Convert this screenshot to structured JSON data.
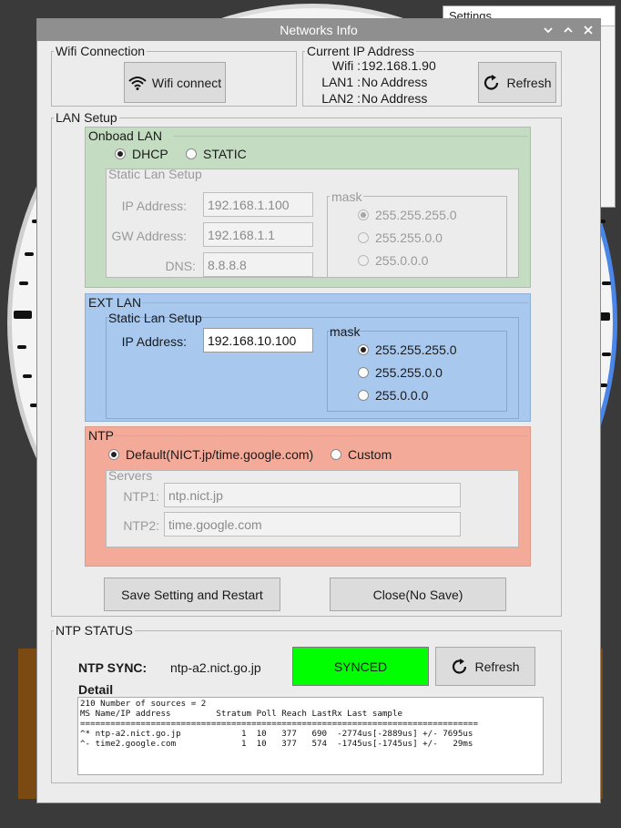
{
  "window": {
    "title": "Networks Info"
  },
  "background": {
    "settings_title": "Settings"
  },
  "wifi": {
    "legend": "Wifi Connection",
    "connect_label": "Wifi connect"
  },
  "current_ip": {
    "legend": "Current IP Address",
    "rows": [
      {
        "label": "Wifi :",
        "value": "192.168.1.90"
      },
      {
        "label": "LAN1 :",
        "value": "No Address"
      },
      {
        "label": "LAN2 :",
        "value": "No Address"
      }
    ],
    "refresh_label": "Refresh"
  },
  "lan_setup": {
    "legend": "LAN Setup",
    "onboard": {
      "legend": "Onboad LAN",
      "dhcp_label": "DHCP",
      "static_label": "STATIC",
      "mode": "DHCP",
      "static_legend": "Static Lan Setup",
      "ip_label": "IP Address:",
      "ip_value": "192.168.1.100",
      "gw_label": "GW Address:",
      "gw_value": "192.168.1.1",
      "dns_label": "DNS:",
      "dns_value": "8.8.8.8",
      "mask_legend": "mask",
      "masks": [
        "255.255.255.0",
        "255.255.0.0",
        "255.0.0.0"
      ],
      "mask_selected": 0
    },
    "ext": {
      "legend": "EXT LAN",
      "static_legend": "Static Lan Setup",
      "ip_label": "IP Address:",
      "ip_value": "192.168.10.100",
      "mask_legend": "mask",
      "masks": [
        "255.255.255.0",
        "255.255.0.0",
        "255.0.0.0"
      ],
      "mask_selected": 0
    },
    "ntp": {
      "legend": "NTP",
      "default_label": "Default(NICT.jp/time.google.com)",
      "custom_label": "Custom",
      "selected": "default",
      "servers_legend": "Servers",
      "ntp1_label": "NTP1:",
      "ntp1_value": "ntp.nict.jp",
      "ntp2_label": "NTP2:",
      "ntp2_value": "time.google.com"
    },
    "save_label": "Save Setting and Restart",
    "close_label": "Close(No Save)"
  },
  "ntp_status": {
    "legend": "NTP STATUS",
    "sync_label": "NTP SYNC:",
    "sync_server": "ntp-a2.nict.go.jp",
    "sync_state": "SYNCED",
    "sync_color": "#00ff00",
    "refresh_label": "Refresh",
    "detail_label": "Detail",
    "detail_lines": [
      "210 Number of sources = 2",
      "MS Name/IP address         Stratum Poll Reach LastRx Last sample",
      "===============================================================================",
      "^* ntp-a2.nict.go.jp            1  10   377   690  -2774us[-2889us] +/- 7695us",
      "^- time2.google.com             1  10   377   574  -1745us[-1745us] +/-   29ms"
    ]
  }
}
